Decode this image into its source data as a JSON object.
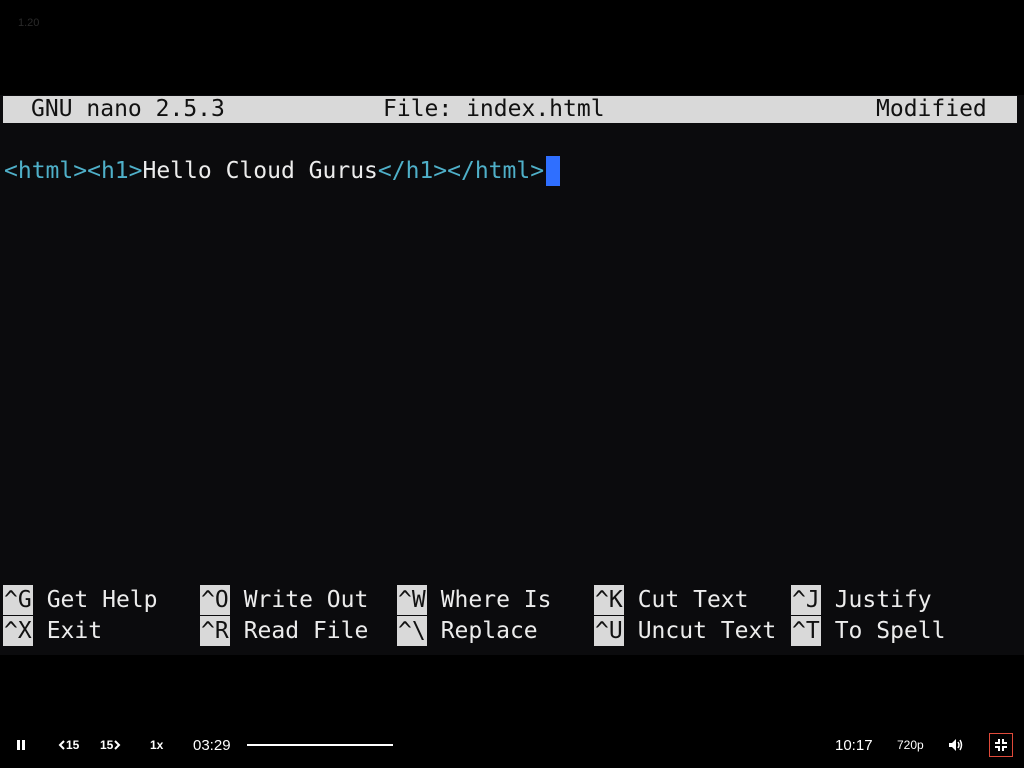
{
  "player": {
    "version_badge": "1.20",
    "speed": "1x",
    "current_time": "03:29",
    "total_time": "10:17",
    "quality": "720p",
    "skip_back": "15",
    "skip_forward": "15",
    "progress": 0.339
  },
  "nano": {
    "app": "GNU nano 2.5.3",
    "file": "File: index.html",
    "status": "Modified",
    "line": {
      "t1": "<html>",
      "t2": "<h1>",
      "content": "Hello Cloud Gurus",
      "t3": "</h1>",
      "t4": "</html>"
    },
    "shortcuts_row1": [
      {
        "key": "^G",
        "label": "Get Help"
      },
      {
        "key": "^O",
        "label": "Write Out"
      },
      {
        "key": "^W",
        "label": "Where Is"
      },
      {
        "key": "^K",
        "label": "Cut Text"
      },
      {
        "key": "^J",
        "label": "Justify"
      }
    ],
    "shortcuts_row2": [
      {
        "key": "^X",
        "label": "Exit"
      },
      {
        "key": "^R",
        "label": "Read File"
      },
      {
        "key": "^\\",
        "label": "Replace"
      },
      {
        "key": "^U",
        "label": "Uncut Text"
      },
      {
        "key": "^T",
        "label": "To Spell"
      }
    ]
  }
}
